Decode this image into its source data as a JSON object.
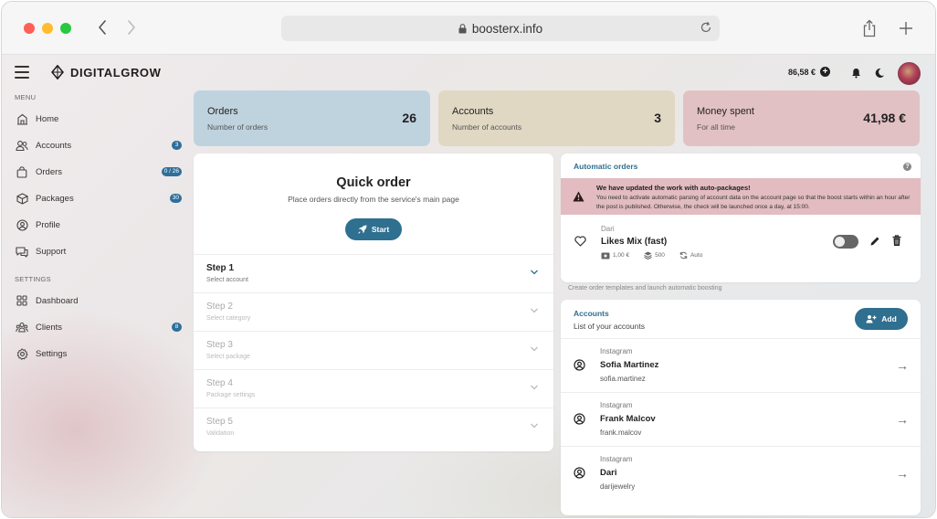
{
  "browser": {
    "url": "boosterx.info",
    "traffic_lights": [
      "#fe5f57",
      "#febc2e",
      "#28c840"
    ]
  },
  "app": {
    "brand": "DIGITALGROW",
    "balance": "86,58 €",
    "accent": "#2f6f8f"
  },
  "sidebar": {
    "menu_heading": "MENU",
    "items": [
      {
        "label": "Home",
        "icon": "home-icon",
        "badge": ""
      },
      {
        "label": "Accounts",
        "icon": "users-icon",
        "badge": "3"
      },
      {
        "label": "Orders",
        "icon": "bag-icon",
        "badge": "0 / 26"
      },
      {
        "label": "Packages",
        "icon": "box-icon",
        "badge": "30"
      },
      {
        "label": "Profile",
        "icon": "user-circle-icon",
        "badge": ""
      },
      {
        "label": "Support",
        "icon": "chat-icon",
        "badge": ""
      }
    ],
    "settings_heading": "SETTINGS",
    "settings_items": [
      {
        "label": "Dashboard",
        "icon": "grid-icon",
        "badge": ""
      },
      {
        "label": "Clients",
        "icon": "clients-icon",
        "badge": "8"
      },
      {
        "label": "Settings",
        "icon": "gear-icon",
        "badge": ""
      }
    ]
  },
  "stats": [
    {
      "title": "Orders",
      "subtitle": "Number of orders",
      "value": "26",
      "color": "#bfd3df"
    },
    {
      "title": "Accounts",
      "subtitle": "Number of accounts",
      "value": "3",
      "color": "#e0d8c3"
    },
    {
      "title": "Money spent",
      "subtitle": "For all time",
      "value": "41,98 €",
      "color": "#e2c1c4"
    }
  ],
  "quick_order": {
    "title": "Quick order",
    "subtitle": "Place orders directly from the service's main page",
    "start_label": "Start",
    "steps": [
      {
        "title": "Step 1",
        "subtitle": "Select account"
      },
      {
        "title": "Step 2",
        "subtitle": "Select category"
      },
      {
        "title": "Step 3",
        "subtitle": "Select package"
      },
      {
        "title": "Step 4",
        "subtitle": "Package settings"
      },
      {
        "title": "Step 5",
        "subtitle": "Validation"
      }
    ]
  },
  "automatic_orders": {
    "heading": "Automatic orders",
    "help": "?",
    "alert_title": "We have updated the work with auto-packages!",
    "alert_body": "You need to activate automatic parsing of account data on the account page so that the boost starts within an hour after the post is published. Otherwise, the check will be launched once a day, at 15:00.",
    "template": {
      "account": "Dari",
      "name": "Likes Mix (fast)",
      "price": "1,00 €",
      "quantity": "500",
      "mode": "Auto",
      "enabled": false
    },
    "hint": "Create order templates and launch automatic boosting"
  },
  "accounts": {
    "title": "Accounts",
    "subtitle": "List of your accounts",
    "add_label": "Add",
    "list": [
      {
        "platform": "Instagram",
        "name": "Sofia Martinez",
        "handle": "sofia.martinez"
      },
      {
        "platform": "Instagram",
        "name": "Frank Malcov",
        "handle": "frank.malcov"
      },
      {
        "platform": "Instagram",
        "name": "Dari",
        "handle": "darijewelry"
      }
    ]
  }
}
